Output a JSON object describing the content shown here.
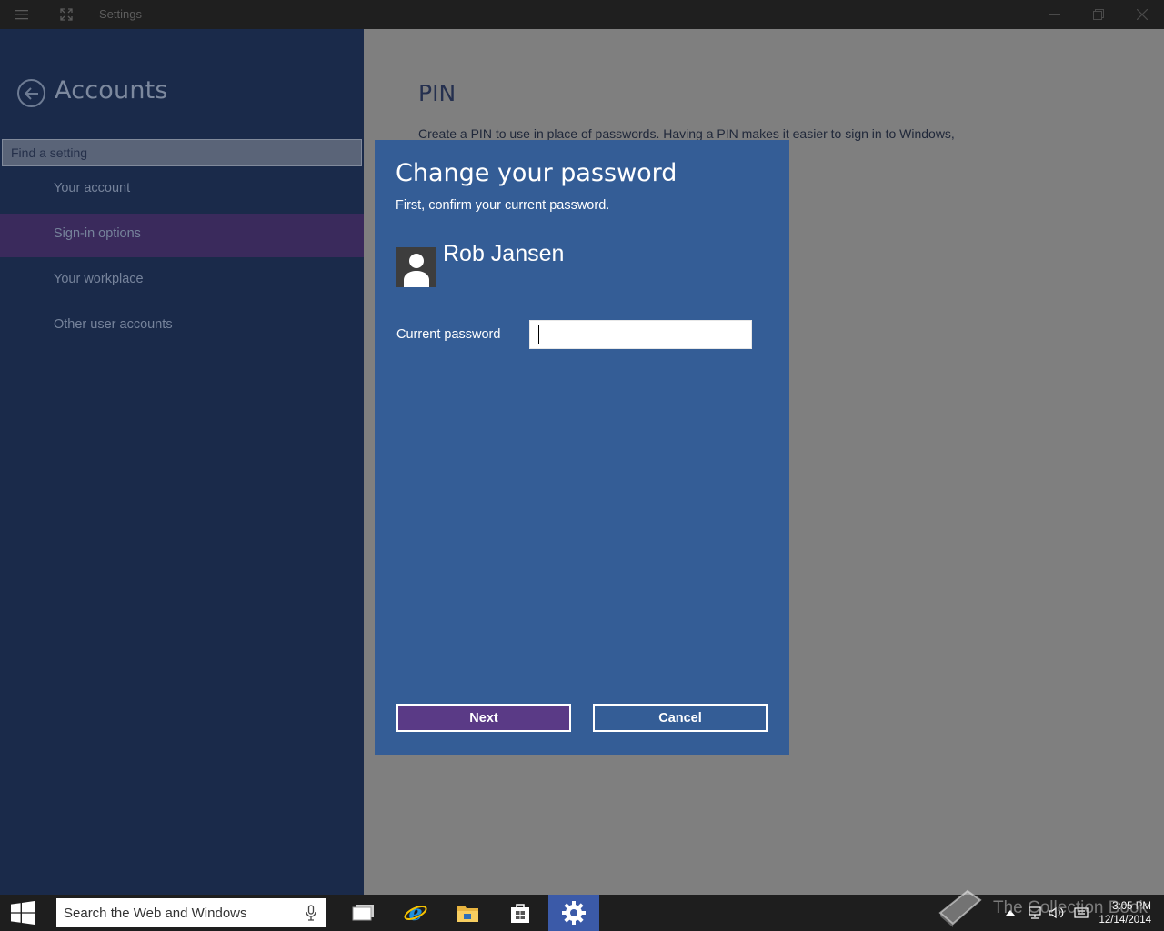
{
  "window": {
    "title": "Settings"
  },
  "sidebar": {
    "title": "Accounts",
    "search_placeholder": "Find a setting",
    "items": [
      {
        "label": "Your account"
      },
      {
        "label": "Sign-in options"
      },
      {
        "label": "Your workplace"
      },
      {
        "label": "Other user accounts"
      }
    ],
    "active_index": 1
  },
  "main": {
    "heading": "PIN",
    "text": "Create a PIN to use in place of passwords. Having a PIN makes it easier to sign in to Windows,"
  },
  "dialog": {
    "title": "Change your password",
    "subtitle": "First, confirm your current password.",
    "user_name": "Rob Jansen",
    "password_label": "Current password",
    "password_value": "",
    "next_label": "Next",
    "cancel_label": "Cancel"
  },
  "taskbar": {
    "search_placeholder": "Search the Web and Windows",
    "time": "3:05 PM",
    "date": "12/14/2014",
    "apps": [
      "task-view",
      "internet-explorer",
      "file-explorer",
      "store",
      "settings"
    ],
    "active_app": "settings"
  },
  "watermark": "The Collection Book",
  "colors": {
    "sidebar_bg": "#1a2a4a",
    "dialog_bg": "#345d96",
    "active_nav": "#3a2a5c",
    "next_button": "#5a3a86",
    "taskbar_active": "#3b5aa8"
  }
}
